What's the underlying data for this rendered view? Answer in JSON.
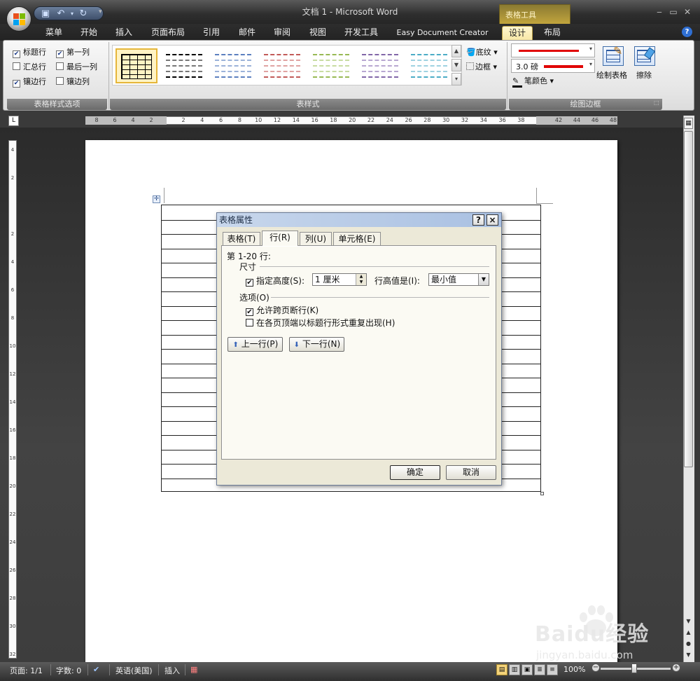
{
  "window": {
    "title": "文档 1 - Microsoft Word",
    "context_tab_group": "表格工具"
  },
  "ribbon_tabs": [
    "菜单",
    "开始",
    "插入",
    "页面布局",
    "引用",
    "邮件",
    "审阅",
    "视图",
    "开发工具",
    "Easy Document Creator",
    "设计",
    "布局"
  ],
  "ribbon": {
    "style_options": {
      "header_row": "标题行",
      "first_column": "第一列",
      "total_row": "汇总行",
      "last_column": "最后一列",
      "banded_rows": "镶边行",
      "banded_columns": "镶边列",
      "group_label": "表格样式选项"
    },
    "table_styles": {
      "group_label": "表样式",
      "shading": "底纹",
      "borders": "边框"
    },
    "draw_borders": {
      "pen_weight": "3.0 磅",
      "pen_color": "笔颜色",
      "draw_table": "绘制表格",
      "eraser": "擦除",
      "group_label": "绘图边框",
      "pen_color_hex": "#e00000"
    }
  },
  "ruler": {
    "h_numbers": [
      "8",
      "6",
      "4",
      "2",
      "2",
      "4",
      "6",
      "8",
      "10",
      "12",
      "14",
      "16",
      "18",
      "20",
      "22",
      "24",
      "26",
      "28",
      "30",
      "32",
      "34",
      "36",
      "38",
      "42",
      "44",
      "46",
      "48"
    ],
    "v_numbers": [
      "4",
      "2",
      "2",
      "4",
      "6",
      "8",
      "10",
      "12",
      "14",
      "16",
      "18",
      "20",
      "22",
      "24",
      "26",
      "28",
      "30",
      "32"
    ]
  },
  "dialog": {
    "title": "表格属性",
    "help": "?",
    "close": "×",
    "tabs": [
      "表格(T)",
      "行(R)",
      "列(U)",
      "单元格(E)"
    ],
    "rows_label": "第 1-20 行:",
    "size_section": "尺寸",
    "specify_height_label": "指定高度(S):",
    "height_value": "1 厘米",
    "row_height_is_label": "行高值是(I):",
    "row_height_mode": "最小值",
    "options_section": "选项(O)",
    "allow_break_label": "允许跨页断行(K)",
    "repeat_header_label": "在各页顶端以标题行形式重复出现(H)",
    "prev_row": "上一行(P)",
    "next_row": "下一行(N)",
    "ok": "确定",
    "cancel": "取消",
    "specify_height_checked": true,
    "allow_break_checked": true,
    "repeat_header_checked": false
  },
  "status": {
    "page": "页面: 1/1",
    "words": "字数: 0",
    "language": "英语(美国)",
    "insert_mode": "插入",
    "zoom": "100%"
  },
  "watermark": {
    "brand": "Baidu经验",
    "url": "jingyan.baidu.com"
  },
  "table": {
    "row_count": 20
  }
}
